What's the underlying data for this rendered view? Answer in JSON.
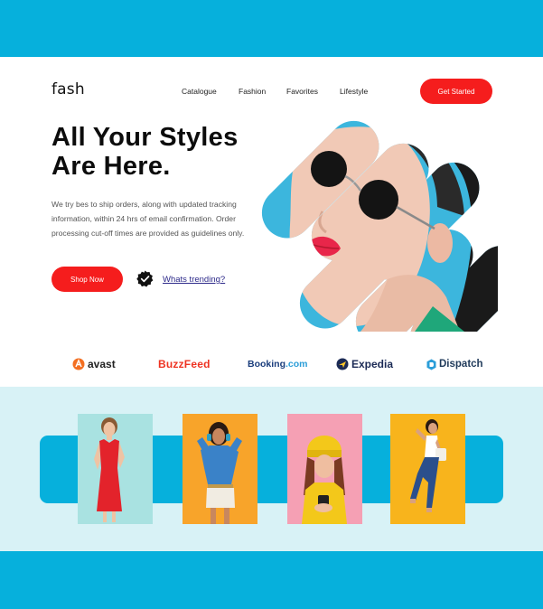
{
  "brand": {
    "logo": "fash"
  },
  "nav": {
    "items": [
      "Catalogue",
      "Fashion",
      "Favorites",
      "Lifestyle"
    ],
    "cta_label": "Get Started"
  },
  "hero": {
    "title_line1": "All Your Styles",
    "title_line2": "Are Here.",
    "description": "We try bes to ship orders, along with updated tracking information, within 24 hrs of email confirmation. Order processing cut-off times are provided as guidelines only.",
    "shop_label": "Shop Now",
    "trending_label": "Whats trending?"
  },
  "partners": {
    "avast": "avast",
    "buzzfeed": "BuzzFeed",
    "booking_main": "Booking",
    "booking_tld": ".com",
    "expedia": "Expedia",
    "dispatch": "Dispatch"
  },
  "gallery": {
    "cards": [
      {
        "background": "#a9e2e1",
        "icon": "model-red-dress"
      },
      {
        "background": "#f8a42a",
        "icon": "model-headphones"
      },
      {
        "background": "#f5a0b4",
        "icon": "model-yellow-beanie"
      },
      {
        "background": "#f8b41c",
        "icon": "model-jumping"
      }
    ]
  },
  "colors": {
    "accent_red": "#f51d1d",
    "brand_blue": "#06b0dc",
    "gallery_bg": "#d8f2f6",
    "link_purple": "#2d2a8a"
  }
}
